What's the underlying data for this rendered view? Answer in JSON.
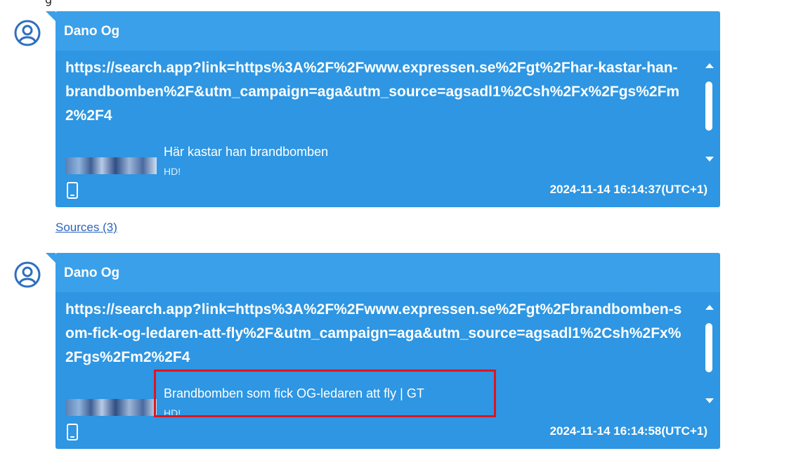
{
  "top_fragment": "g",
  "messages": [
    {
      "sender": "Dano Og",
      "link": "https://search.app?link=https%3A%2F%2Fwww.expressen.se%2Fgt%2Fhar-kastar-han-brandbomben%2F&utm_campaign=aga&utm_source=agsadl1%2Csh%2Fx%2Fgs%2Fm2%2F4",
      "preview_title": "Här kastar han brandbomben",
      "preview_sub": "HD!",
      "timestamp": "2024-11-14 16:14:37(UTC+1)"
    },
    {
      "sender": "Dano Og",
      "link": "https://search.app?link=https%3A%2F%2Fwww.expressen.se%2Fgt%2Fbrandbomben-som-fick-og-ledaren-att-fly%2F&utm_campaign=aga&utm_source=agsadl1%2Csh%2Fx%2Fgs%2Fm2%2F4",
      "preview_title": "Brandbomben som fick OG-ledaren att fly | GT",
      "preview_sub": "HD!",
      "timestamp": "2024-11-14 16:14:58(UTC+1)"
    }
  ],
  "sources_label": "Sources (3)",
  "colors": {
    "bubble": "#2e96e2",
    "header": "#3aa0ea",
    "highlight": "#e0141e",
    "link": "#2a63b8"
  },
  "icons": [
    "avatar-icon",
    "phone-icon",
    "scroll-up-icon",
    "scroll-down-icon"
  ]
}
